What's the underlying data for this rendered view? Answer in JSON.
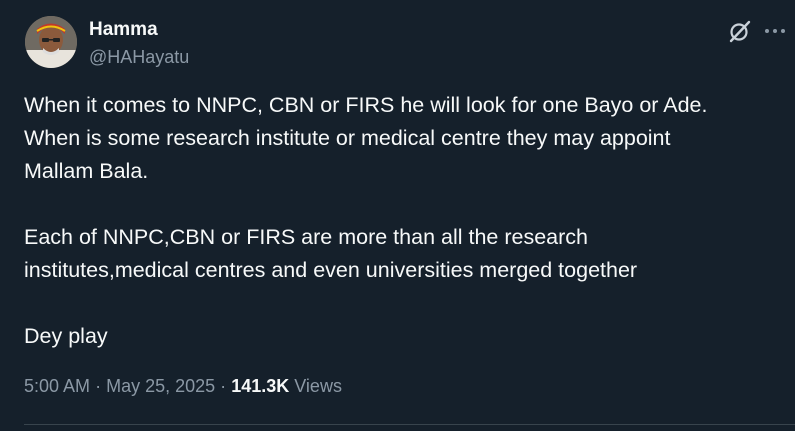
{
  "author": {
    "name": "Hamma",
    "handle": "@HAHayatu"
  },
  "icons": {
    "avatar": "profile-photo",
    "grok": "grok-icon",
    "more": "more-horizontal-icon"
  },
  "tweet": {
    "paragraphs": [
      "When it comes to NNPC, CBN or FIRS he will look for one Bayo or Ade.\nWhen is some research institute or medical centre they may appoint\nMallam Bala.",
      "Each of NNPC,CBN or FIRS are more than all the research\ninstitutes,medical centres and even universities merged together",
      "Dey play"
    ]
  },
  "meta": {
    "time": "5:00 AM",
    "separator": "·",
    "date": "May 25, 2025",
    "views_count": "141.3K",
    "views_label": "Views"
  },
  "colors": {
    "background": "#15202b",
    "text": "#f7f9f9",
    "secondary": "#8b98a5",
    "divider": "#38444d"
  }
}
